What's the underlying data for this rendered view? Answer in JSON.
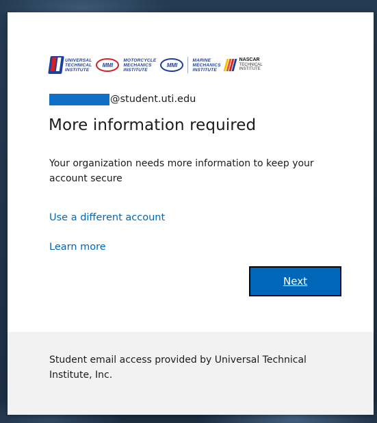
{
  "logos": {
    "uti": [
      "Universal",
      "Technical",
      "Institute"
    ],
    "mmi_label": "MMI",
    "motorcycle": [
      "Motorcycle",
      "Mechanics",
      "Institute"
    ],
    "marine": [
      "Marine",
      "Mechanics",
      "Institute"
    ],
    "nascar": [
      "NASCAR",
      "TECHNICAL",
      "INSTITUTE"
    ]
  },
  "account": {
    "email_domain": "@student.uti.edu"
  },
  "title": "More information required",
  "description": "Your organization needs more information to keep your account secure",
  "links": {
    "different_account": "Use a different account",
    "learn_more": "Learn more"
  },
  "buttons": {
    "next": "Next"
  },
  "footer": {
    "text": "Student email access provided by Universal Technical Institute, Inc."
  },
  "colors": {
    "accent": "#0067b8",
    "redaction": "#0f6fc6",
    "footer_bg": "#f2f2f2"
  }
}
